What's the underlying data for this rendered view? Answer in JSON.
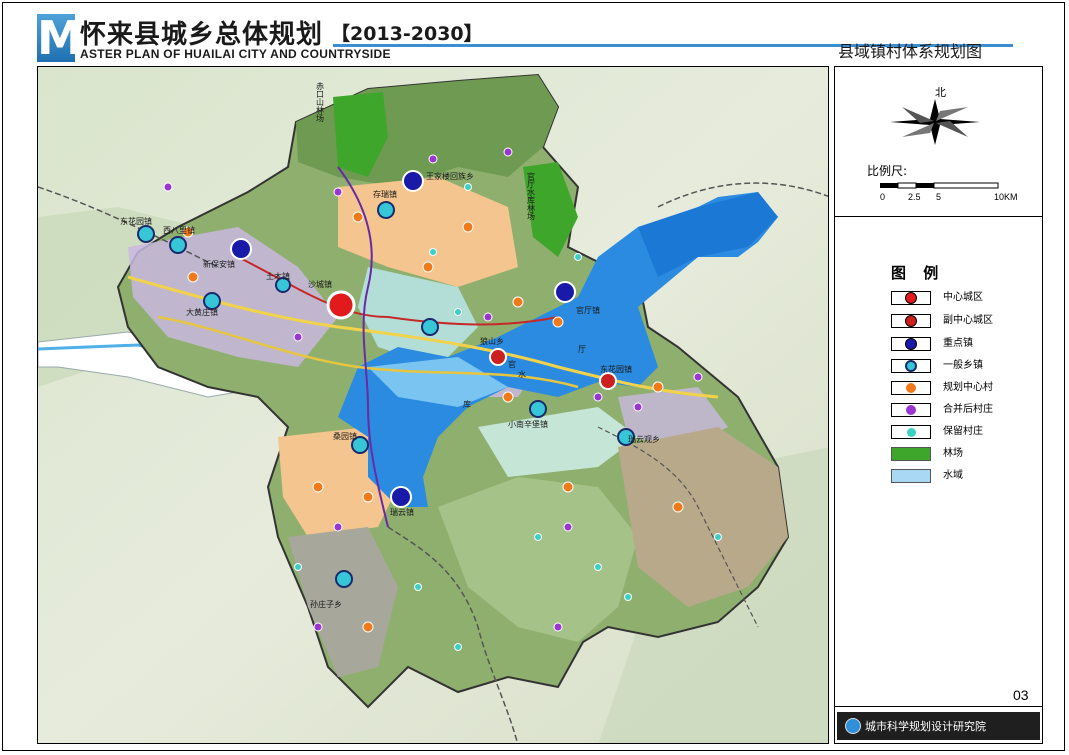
{
  "header": {
    "logo_letter": "M",
    "title_cn": "怀来县城乡总体规划",
    "years": "【2013-2030】",
    "title_en": "ASTER PLAN OF HUAILAI CITY AND COUNTRYSIDE",
    "map_name": "县域镇村体系规划图"
  },
  "map": {
    "labels": {
      "forest1": "赤口山林场",
      "forest2": "官厅水库林场",
      "town_w1": "东花园镇",
      "town_w2": "西八里镇",
      "town_key1": "新保安镇",
      "town_w3": "大黄庄镇",
      "town_key2": "土木镇",
      "city_center": "沙城镇",
      "town_n1": "王家楼回族乡",
      "town_n2": "存瑞镇",
      "town_e1": "官厅镇",
      "town_sub": "狼山乡",
      "town_e2": "东花园镇",
      "water1": "官",
      "water2": "厅",
      "water3": "水",
      "water4": "库",
      "town_c1": "小南辛堡镇",
      "town_e3": "瑞云观乡",
      "town_s1": "桑园镇",
      "town_s2": "瑞云镇",
      "town_s3": "孙庄子乡"
    }
  },
  "sidebar": {
    "north": "北",
    "scale_label": "比例尺:",
    "scale_ticks": [
      "0",
      "2.5",
      "5",
      "10KM"
    ],
    "legend_title": "图 例",
    "legend": [
      {
        "label": "中心城区",
        "color": "#e31a1c"
      },
      {
        "label": "副中心城区",
        "color": "#cc2020"
      },
      {
        "label": "重点镇",
        "color": "#1a1aa8"
      },
      {
        "label": "一般乡镇",
        "color": "#36c6d8"
      },
      {
        "label": "规划中心村",
        "color": "#f07a1a"
      },
      {
        "label": "合并后村庄",
        "color": "#9b35d1"
      },
      {
        "label": "保留村庄",
        "color": "#3ad1c4"
      },
      {
        "label": "林场",
        "color": "#3ea62b"
      },
      {
        "label": "水域",
        "color": "#a9d8f5"
      }
    ],
    "page_number": "03",
    "institute": "城市科学规划设计研究院"
  }
}
